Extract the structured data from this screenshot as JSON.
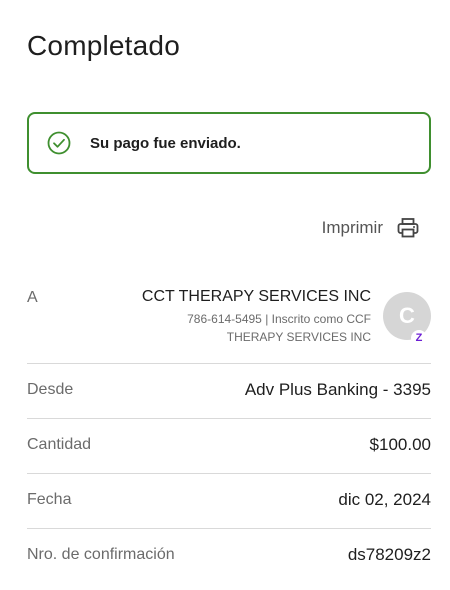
{
  "page": {
    "title": "Completado"
  },
  "banner": {
    "message": "Su pago fue enviado.",
    "icon": "check-circle-icon",
    "accent": "#3f8f2f"
  },
  "print": {
    "label": "Imprimir",
    "icon": "printer-icon"
  },
  "recipient": {
    "key": "A",
    "name": "CCT THERAPY SERVICES INC",
    "detail_line1": "786-614-5495 | Inscrito como CCF",
    "detail_line2": "THERAPY SERVICES INC",
    "avatar_initial": "C",
    "badge": "Z",
    "badge_color": "#6d1ed4"
  },
  "details": [
    {
      "key": "Desde",
      "value": "Adv Plus Banking - 3395"
    },
    {
      "key": "Cantidad",
      "value": "$100.00"
    },
    {
      "key": "Fecha",
      "value": "dic 02, 2024"
    },
    {
      "key": "Nro. de confirmación",
      "value": "ds78209z2"
    }
  ]
}
